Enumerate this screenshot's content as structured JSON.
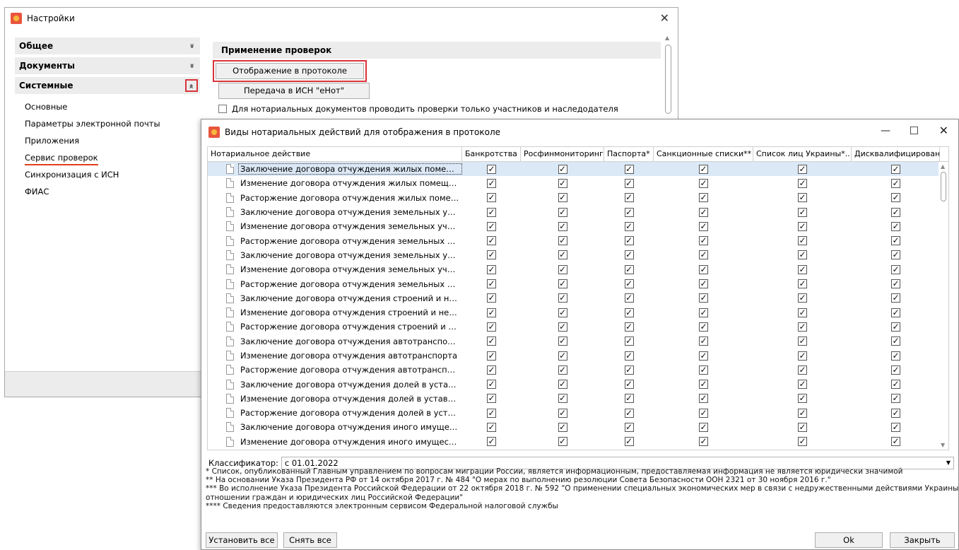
{
  "settings": {
    "title": "Настройки",
    "sidebar": {
      "sections": [
        {
          "label": "Общее",
          "chevron": "»"
        },
        {
          "label": "Документы",
          "chevron": "»"
        },
        {
          "label": "Системные",
          "chevron": "«"
        }
      ],
      "items": [
        "Основные",
        "Параметры электронной почты",
        "Приложения",
        "Сервис проверок",
        "Синхронизация с ИСН",
        "ФИАС"
      ]
    },
    "main": {
      "section_title": "Применение проверок",
      "btn_protocol": "Отображение в протоколе",
      "btn_isn": "Передача в ИСН \"еНот\"",
      "checkbox_label": "Для нотариальных документов проводить проверки только участников и наследодателя"
    }
  },
  "dialog": {
    "title": "Виды нотариальных действий для отображения в протоколе",
    "columns": [
      "Нотариальное действие",
      "Банкротства",
      "Росфинмониторинг",
      "Паспорта*",
      "Санкционные списки**",
      "Список лиц Украины*...",
      "Дисквалифицированн..."
    ],
    "rows": [
      "Заключение договора отчуждения жилых помещений",
      "Изменение договора отчуждения жилых помещений",
      "Расторжение договора отчуждения жилых помещений",
      "Заключение договора отчуждения земельных участков",
      "Изменение договора отчуждения земельных участков",
      "Расторжение договора отчуждения земельных участк...",
      "Заключение договора отчуждения земельных участк...",
      "Изменение договора отчуждения земельных участков...",
      "Расторжение договора отчуждения земельных участк...",
      "Заключение договора отчуждения строений и нежил...",
      "Изменение договора отчуждения строений и нежилых...",
      "Расторжение договора отчуждения строений и нежил...",
      "Заключение договора отчуждения автотранспорта",
      "Изменение договора отчуждения автотранспорта",
      "Расторжение договора отчуждения автотранспорта",
      "Заключение договора отчуждения долей в уставном ...",
      "Изменение договора отчуждения долей в уставном ка...",
      "Расторжение договора отчуждения долей в уставном ...",
      "Заключение договора отчуждения иного имущества",
      "Изменение договора отчуждения иного имущества"
    ],
    "checkmark": "✓",
    "classifier_label": "Классификатор:",
    "classifier_value": "с 01.01.2022",
    "notes": [
      "* Список, опубликованный Главным управлением по вопросам миграции России, является информационным, предоставляемая информация не является юридически значимой",
      "** На основании Указа Президента РФ от 14 октября 2017 г. № 484 \"О мерах по выполнению резолюции Совета Безопасности ООН 2321 от 30 ноября 2016 г.\"",
      "*** Во исполнение Указа Президента Российской Федерации от 22 октября 2018 г. № 592 \"О применении специальных экономических мер в связи с недружественными действиями Украины в",
      "отношении граждан и юридических лиц Российской Федерации\"",
      "**** Сведения предоставляются электронным сервисом Федеральной налоговой службы"
    ],
    "buttons": {
      "set_all": "Установить все",
      "clear_all": "Снять все",
      "ok": "Ok",
      "close": "Закрыть"
    }
  }
}
